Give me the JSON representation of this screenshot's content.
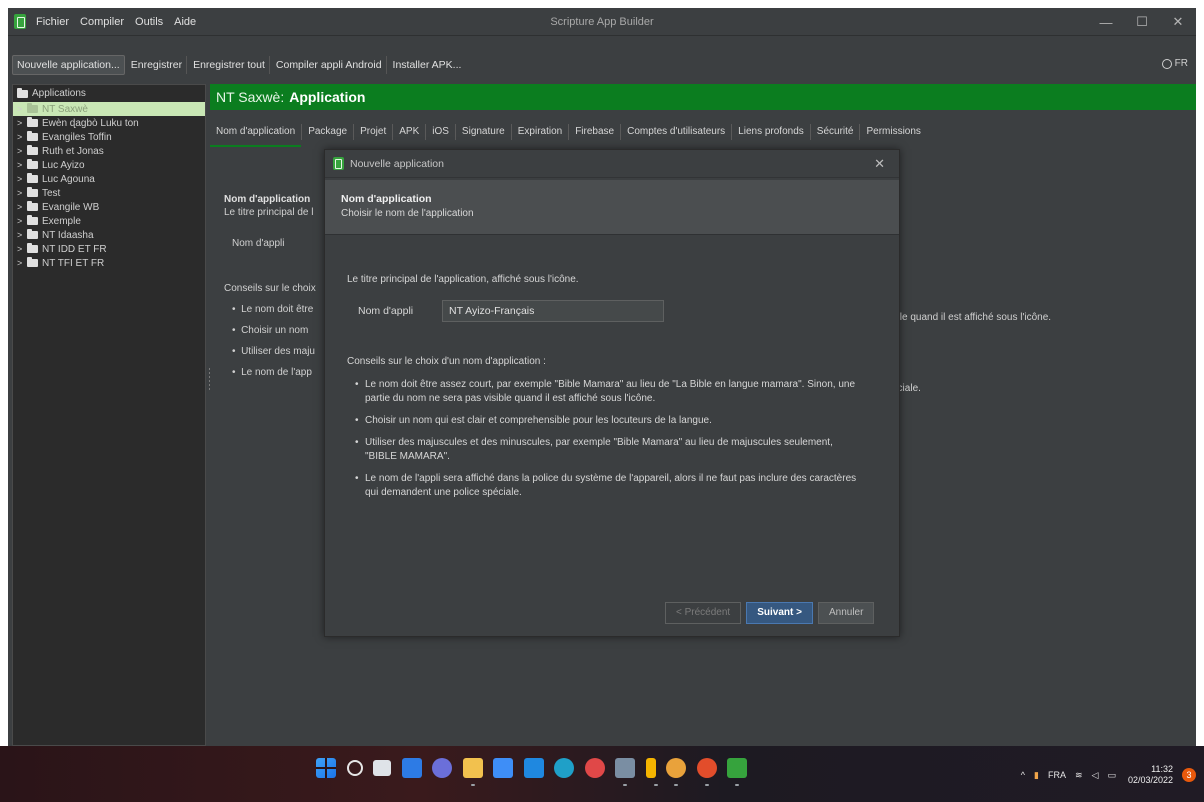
{
  "window": {
    "title": "Scripture App Builder",
    "menu": [
      "Fichier",
      "Compiler",
      "Outils",
      "Aide"
    ],
    "controls": [
      "—",
      "☐",
      "✕"
    ]
  },
  "toolbar": {
    "buttons": [
      "Nouvelle application...",
      "Enregistrer",
      "Enregistrer tout",
      "Compiler appli Android",
      "Installer APK..."
    ],
    "language": "FR"
  },
  "sidebar": {
    "root": "Applications",
    "items": [
      {
        "label": "NT Saxwè",
        "selected": true
      },
      {
        "label": "Ewèn ɖagbò Luku ton",
        "selected": false
      },
      {
        "label": "Evangiles Toffin",
        "selected": false
      },
      {
        "label": "Ruth et Jonas",
        "selected": false
      },
      {
        "label": "Luc Ayizo",
        "selected": false
      },
      {
        "label": "Luc Agouna",
        "selected": false
      },
      {
        "label": "Test",
        "selected": false
      },
      {
        "label": "Evangile WB",
        "selected": false
      },
      {
        "label": "Exemple",
        "selected": false
      },
      {
        "label": "NT Idaasha",
        "selected": false
      },
      {
        "label": "NT IDD ET FR",
        "selected": false
      },
      {
        "label": "NT TFI ET FR",
        "selected": false
      }
    ]
  },
  "main": {
    "header_prefix": "NT Saxwè:",
    "header_title": "Application",
    "tabs": [
      "Nom d'application",
      "Package",
      "Projet",
      "APK",
      "iOS",
      "Signature",
      "Expiration",
      "Firebase",
      "Comptes d'utilisateurs",
      "Liens profonds",
      "Sécurité",
      "Permissions"
    ],
    "bg_title": "Nom d'application",
    "bg_sub": "Le titre principal de l",
    "bg_field": "Nom d'appli",
    "bg_tips": "Conseils sur le choix",
    "bg_bullets": [
      "Le nom doit être",
      "Choisir un nom",
      "Utiliser des maju",
      "Le nom de l'app"
    ],
    "bg_right_1": "ible quand il est affiché sous l'icône.",
    "bg_right_2": "éciale."
  },
  "dialog": {
    "title": "Nouvelle application",
    "close": "✕",
    "head_title": "Nom d'application",
    "head_sub": "Choisir le nom de l'application",
    "intro": "Le titre principal de l'application, affiché sous l'icône.",
    "field_label": "Nom d'appli",
    "field_value": "NT Ayizo-Français",
    "tips_title": "Conseils sur le choix d'un nom d'application :",
    "tips": [
      "Le nom doit être assez court, par exemple \"Bible Mamara\" au lieu de \"La Bible en langue mamara\". Sinon, une partie du nom ne sera pas visible quand il est affiché sous l'icône.",
      "Choisir un nom qui est clair et comprehensible pour les locuteurs de la langue.",
      "Utiliser des majuscules et des minuscules, par exemple \"Bible Mamara\" au lieu de majuscules seulement, \"BIBLE MAMARA\".",
      "Le nom de l'appli sera affiché dans la police du système de l'appareil, alors il ne faut pas inclure des caractères qui demandent une police spéciale."
    ],
    "btn_prev": "< Précédent",
    "btn_next": "Suivant >",
    "btn_cancel": "Annuler"
  },
  "taskbar": {
    "lang": "FRA",
    "time": "11:32",
    "date": "02/03/2022",
    "notifications": "3"
  }
}
